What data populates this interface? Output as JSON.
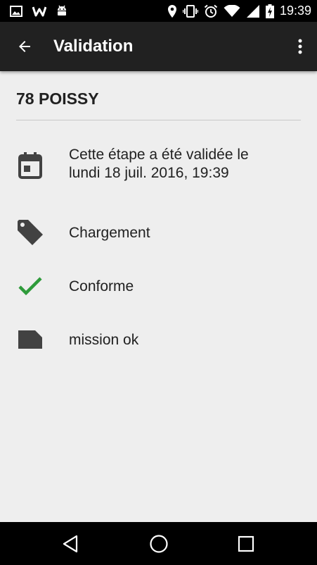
{
  "status_bar": {
    "time": "19:39",
    "left_icons": [
      "gallery-icon",
      "w-app-icon",
      "android-icon"
    ],
    "right_icons": [
      "location-icon",
      "vibrate-icon",
      "alarm-icon",
      "wifi-icon",
      "signal-icon",
      "battery-charging-icon"
    ]
  },
  "app_bar": {
    "title": "Validation",
    "back_icon": "arrow-back-icon",
    "menu_icon": "more-vert-icon",
    "background": "#212121"
  },
  "stage": {
    "name": "78 POISSY"
  },
  "details": [
    {
      "icon": "calendar-icon",
      "line1": "Cette étape a été validée le",
      "line2": "lundi 18 juil. 2016, 19:39"
    },
    {
      "icon": "tag-icon",
      "text": "Chargement"
    },
    {
      "icon": "check-icon",
      "text": "Conforme",
      "color": "#2e9b3a"
    },
    {
      "icon": "note-icon",
      "text": "mission ok"
    }
  ],
  "nav_bar": {
    "buttons": [
      "back-triangle-icon",
      "home-circle-icon",
      "recents-square-icon"
    ]
  }
}
